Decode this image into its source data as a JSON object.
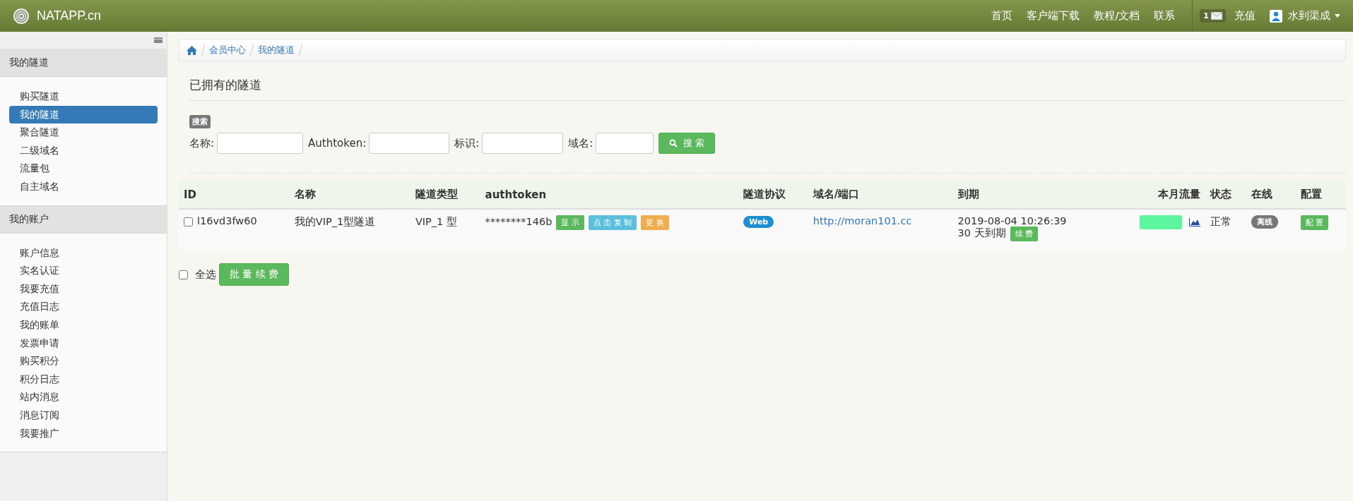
{
  "header": {
    "brand": "NATAPP.cn",
    "nav": [
      "首页",
      "客户端下载",
      "教程/文档",
      "联系"
    ],
    "message_count": "1",
    "recharge": "充值",
    "user": "水到渠成"
  },
  "sidebar": {
    "sections": [
      {
        "title": "我的隧道",
        "items": [
          {
            "label": "购买隧道",
            "selected": false
          },
          {
            "label": "我的隧道",
            "selected": true
          },
          {
            "label": "聚合隧道",
            "selected": false
          },
          {
            "label": "二级域名",
            "selected": false
          },
          {
            "label": "流量包",
            "selected": false
          },
          {
            "label": "自主域名",
            "selected": false
          }
        ]
      },
      {
        "title": "我的账户",
        "items": [
          {
            "label": "账户信息",
            "selected": false
          },
          {
            "label": "实名认证",
            "selected": false
          },
          {
            "label": "我要充值",
            "selected": false
          },
          {
            "label": "充值日志",
            "selected": false
          },
          {
            "label": "我的账单",
            "selected": false
          },
          {
            "label": "发票申请",
            "selected": false
          },
          {
            "label": "购买积分",
            "selected": false
          },
          {
            "label": "积分日志",
            "selected": false
          },
          {
            "label": "站内消息",
            "selected": false
          },
          {
            "label": "消息订阅",
            "selected": false
          },
          {
            "label": "我要推广",
            "selected": false
          }
        ]
      }
    ]
  },
  "breadcrumb": [
    "会员中心",
    "我的隧道"
  ],
  "page_title": "已拥有的隧道",
  "search": {
    "badge": "搜索",
    "fields": [
      {
        "label": "名称:"
      },
      {
        "label": "Authtoken:"
      },
      {
        "label": "标识:"
      },
      {
        "label": "域名:"
      }
    ],
    "button": "搜 索"
  },
  "table": {
    "columns": [
      "ID",
      "名称",
      "隧道类型",
      "authtoken",
      "隧道协议",
      "域名/端口",
      "到期",
      "本月流量",
      "状态",
      "在线",
      "配置"
    ],
    "rows": [
      {
        "checked": false,
        "id": "l16vd3fw60",
        "name": "我的VIP_1型隧道",
        "type": "VIP_1 型",
        "authtoken": "********146b",
        "show_button": "显 示",
        "copy_button": "点 击 复 制",
        "change_button": "更 换",
        "protocol": "Web",
        "domain": "http://moran101.cc",
        "expiry": "2019-08-04 10:26:39",
        "days_left": "30 天到期",
        "renew_button": "续 费",
        "status": "正常",
        "online": "离线",
        "config_button": "配 置"
      }
    ]
  },
  "footer": {
    "select_all": "全选",
    "select_all_checked": false,
    "batch_renew": "批 量 续 费"
  }
}
